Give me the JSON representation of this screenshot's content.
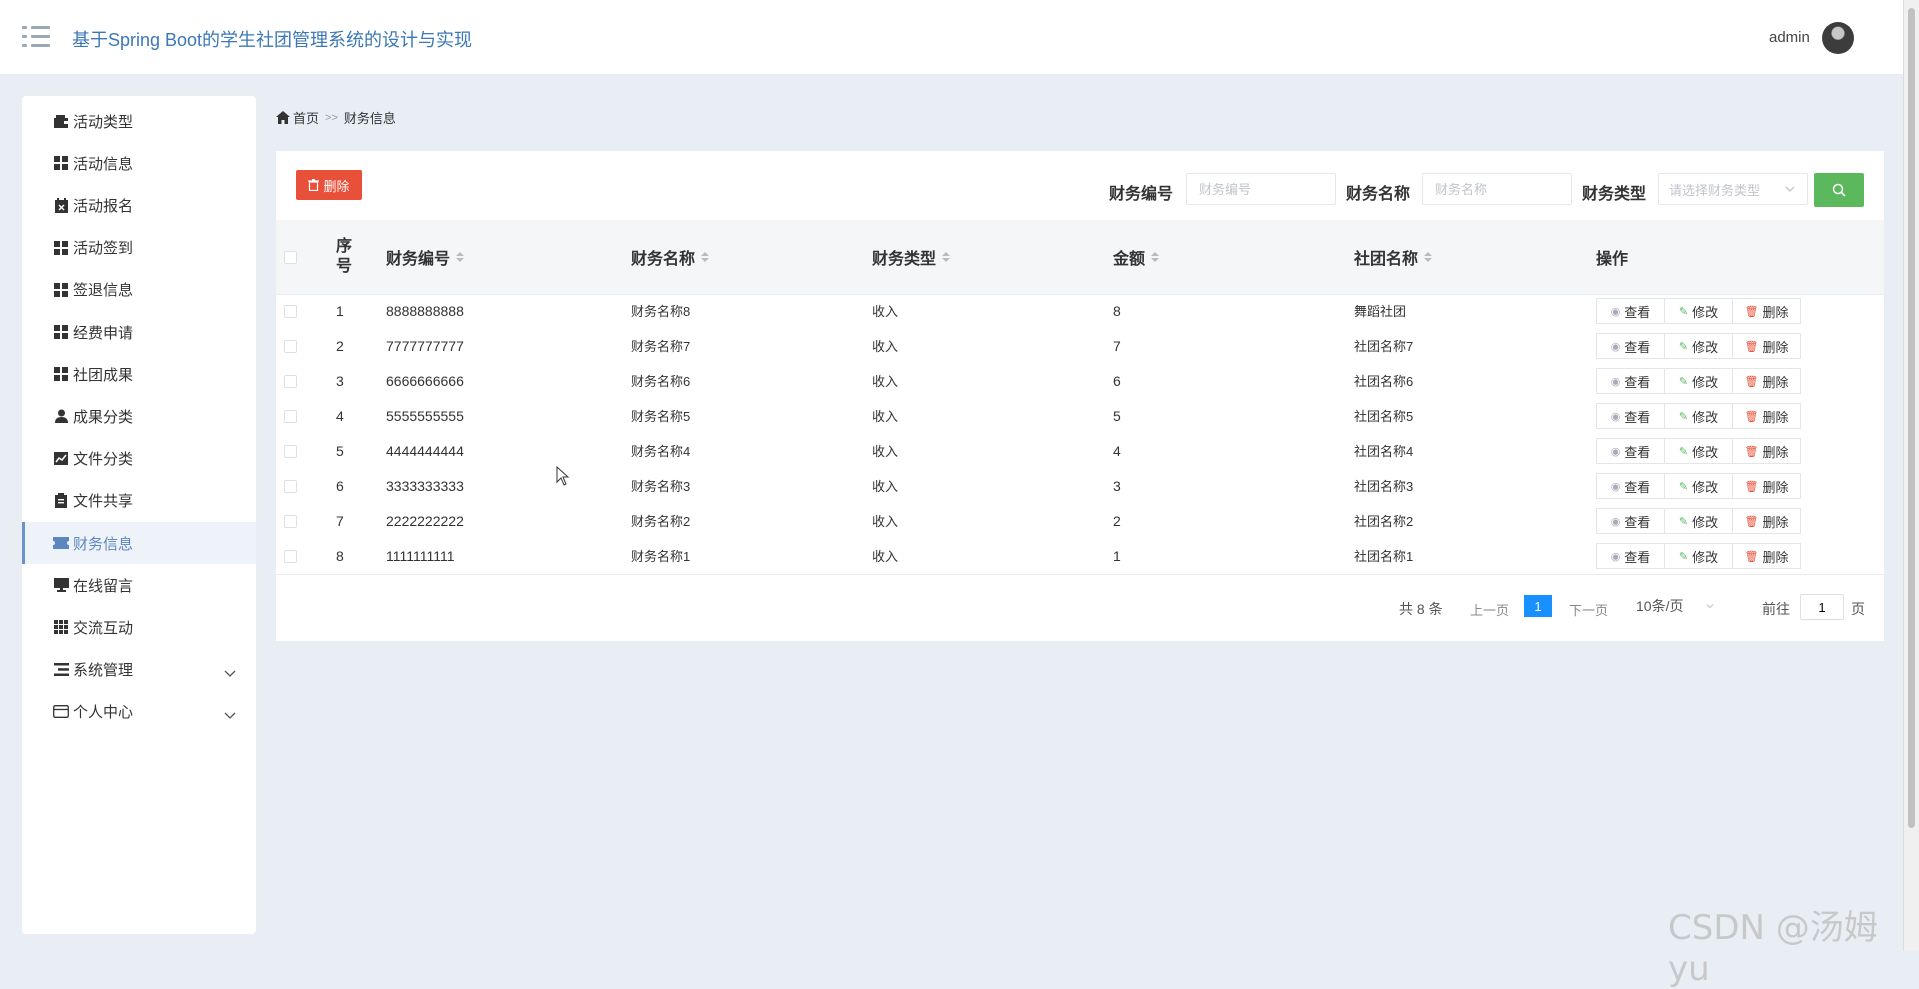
{
  "header": {
    "title": "基于Spring Boot的学生社团管理系统的设计与实现",
    "user": "admin"
  },
  "sidebar": {
    "items": [
      {
        "label": "活动类型",
        "icon": "wallet-icon"
      },
      {
        "label": "活动信息",
        "icon": "grid-icon"
      },
      {
        "label": "活动报名",
        "icon": "calendar-x-icon"
      },
      {
        "label": "活动签到",
        "icon": "grid-icon"
      },
      {
        "label": "签退信息",
        "icon": "grid-icon"
      },
      {
        "label": "经费申请",
        "icon": "grid-icon"
      },
      {
        "label": "社团成果",
        "icon": "grid-icon"
      },
      {
        "label": "成果分类",
        "icon": "user-icon"
      },
      {
        "label": "文件分类",
        "icon": "line-chart-icon"
      },
      {
        "label": "文件共享",
        "icon": "clipboard-icon"
      },
      {
        "label": "财务信息",
        "icon": "ticket-icon",
        "active": true
      },
      {
        "label": "在线留言",
        "icon": "monitor-icon"
      },
      {
        "label": "交流互动",
        "icon": "apps-icon"
      },
      {
        "label": "系统管理",
        "icon": "list-icon",
        "expandable": true
      },
      {
        "label": "个人中心",
        "icon": "card-icon",
        "expandable": true
      }
    ]
  },
  "breadcrumb": {
    "home": "首页",
    "sep": ">>",
    "current": "财务信息"
  },
  "toolbar": {
    "delete_label": "删除",
    "filters": [
      {
        "label": "财务编号",
        "placeholder": "财务编号"
      },
      {
        "label": "财务名称",
        "placeholder": "财务名称"
      },
      {
        "label": "财务类型",
        "placeholder": "请选择财务类型"
      }
    ]
  },
  "table": {
    "index_header": [
      "序",
      "号"
    ],
    "headers": [
      "财务编号",
      "财务名称",
      "财务类型",
      "金额",
      "社团名称",
      "操作"
    ],
    "rows": [
      {
        "no": "1",
        "code": "8888888888",
        "name": "财务名称8",
        "type": "收入",
        "amount": "8",
        "club": "舞蹈社团"
      },
      {
        "no": "2",
        "code": "7777777777",
        "name": "财务名称7",
        "type": "收入",
        "amount": "7",
        "club": "社团名称7"
      },
      {
        "no": "3",
        "code": "6666666666",
        "name": "财务名称6",
        "type": "收入",
        "amount": "6",
        "club": "社团名称6"
      },
      {
        "no": "4",
        "code": "5555555555",
        "name": "财务名称5",
        "type": "收入",
        "amount": "5",
        "club": "社团名称5"
      },
      {
        "no": "5",
        "code": "4444444444",
        "name": "财务名称4",
        "type": "收入",
        "amount": "4",
        "club": "社团名称4"
      },
      {
        "no": "6",
        "code": "3333333333",
        "name": "财务名称3",
        "type": "收入",
        "amount": "3",
        "club": "社团名称3"
      },
      {
        "no": "7",
        "code": "2222222222",
        "name": "财务名称2",
        "type": "收入",
        "amount": "2",
        "club": "社团名称2"
      },
      {
        "no": "8",
        "code": "1111111111",
        "name": "财务名称1",
        "type": "收入",
        "amount": "1",
        "club": "社团名称1"
      }
    ],
    "actions": {
      "view": "查看",
      "edit": "修改",
      "delete": "删除"
    }
  },
  "pagination": {
    "total": "共 8 条",
    "prev": "上一页",
    "current": "1",
    "next": "下一页",
    "page_size": "10条/页",
    "goto_prefix": "前往",
    "goto_value": "1",
    "goto_suffix": "页"
  },
  "watermark": "CSDN @汤姆yu",
  "colors": {
    "accent": "#3c78b5",
    "danger": "#e8503a",
    "success": "#5bb85d",
    "page_active": "#1890ff"
  }
}
